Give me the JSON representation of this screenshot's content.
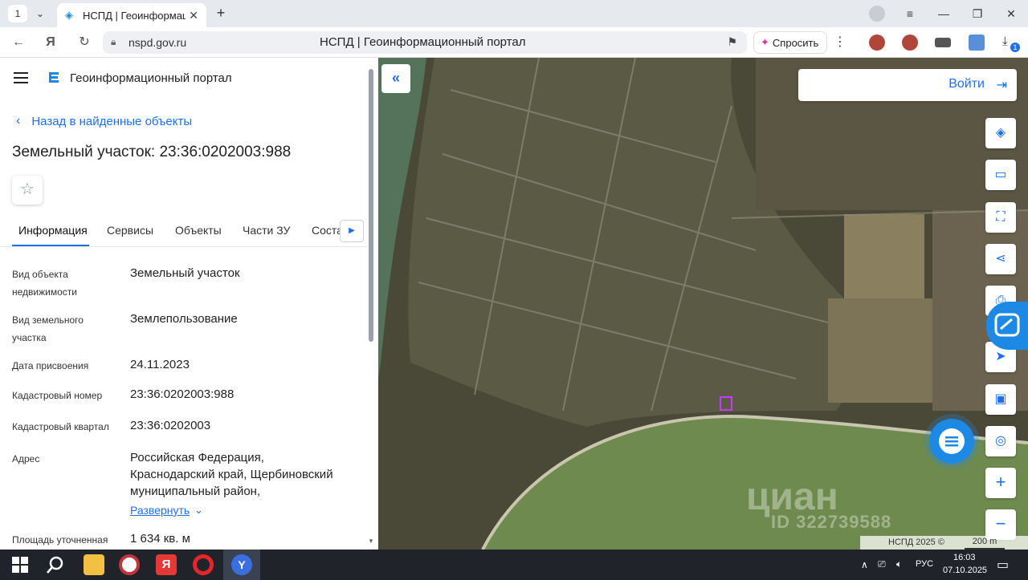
{
  "browser": {
    "tab_counter": "1",
    "tab_title": "НСПД | Геоинформаци",
    "url": "nspd.gov.ru",
    "page_title": "НСПД | Геоинформационный портал",
    "ask_label": "Спросить",
    "download_badge": "1"
  },
  "sidebar": {
    "portal_name": "Геоинформационный портал",
    "back_label": "Назад в найденные объекты",
    "object_title": "Земельный участок: 23:36:0202003:988",
    "tabs": [
      {
        "label": "Информация"
      },
      {
        "label": "Сервисы"
      },
      {
        "label": "Объекты"
      },
      {
        "label": "Части ЗУ"
      },
      {
        "label": "Соста"
      }
    ],
    "properties": [
      {
        "label_lines": [
          "Вид объекта",
          "недвижимости"
        ],
        "value_lines": [
          "Земельный участок"
        ]
      },
      {
        "label_lines": [
          "Вид земельного",
          "участка"
        ],
        "value_lines": [
          "Землепользование"
        ]
      },
      {
        "label_lines": [
          "Дата присвоения"
        ],
        "value_lines": [
          "24.11.2023"
        ]
      },
      {
        "label_lines": [
          "Кадастровый номер"
        ],
        "value_lines": [
          "23:36:0202003:988"
        ]
      },
      {
        "label_lines": [
          "Кадастровый квартал"
        ],
        "value_lines": [
          "23:36:0202003"
        ]
      },
      {
        "label_lines": [
          "Адрес"
        ],
        "value_lines": [
          "Российская Федерация,",
          "Краснодарский край, Щербиновский",
          "муниципальный район,"
        ]
      },
      {
        "label_lines": [
          "Площадь уточненная"
        ],
        "value_lines": [
          "1 634 кв. м"
        ]
      }
    ],
    "expand_label": "Развернуть"
  },
  "map": {
    "login_label": "Войти",
    "watermark": "циан",
    "watermark_id": "ID 322739588",
    "attribution": "НСПД 2025 ©",
    "scale_label": "200 m",
    "colors": {
      "accent": "#1e6ff0",
      "land": "#4a4937",
      "sea": "#6f8a4e"
    }
  },
  "taskbar": {
    "lang": "РУС",
    "time": "16:03",
    "date": "07.10.2025"
  }
}
